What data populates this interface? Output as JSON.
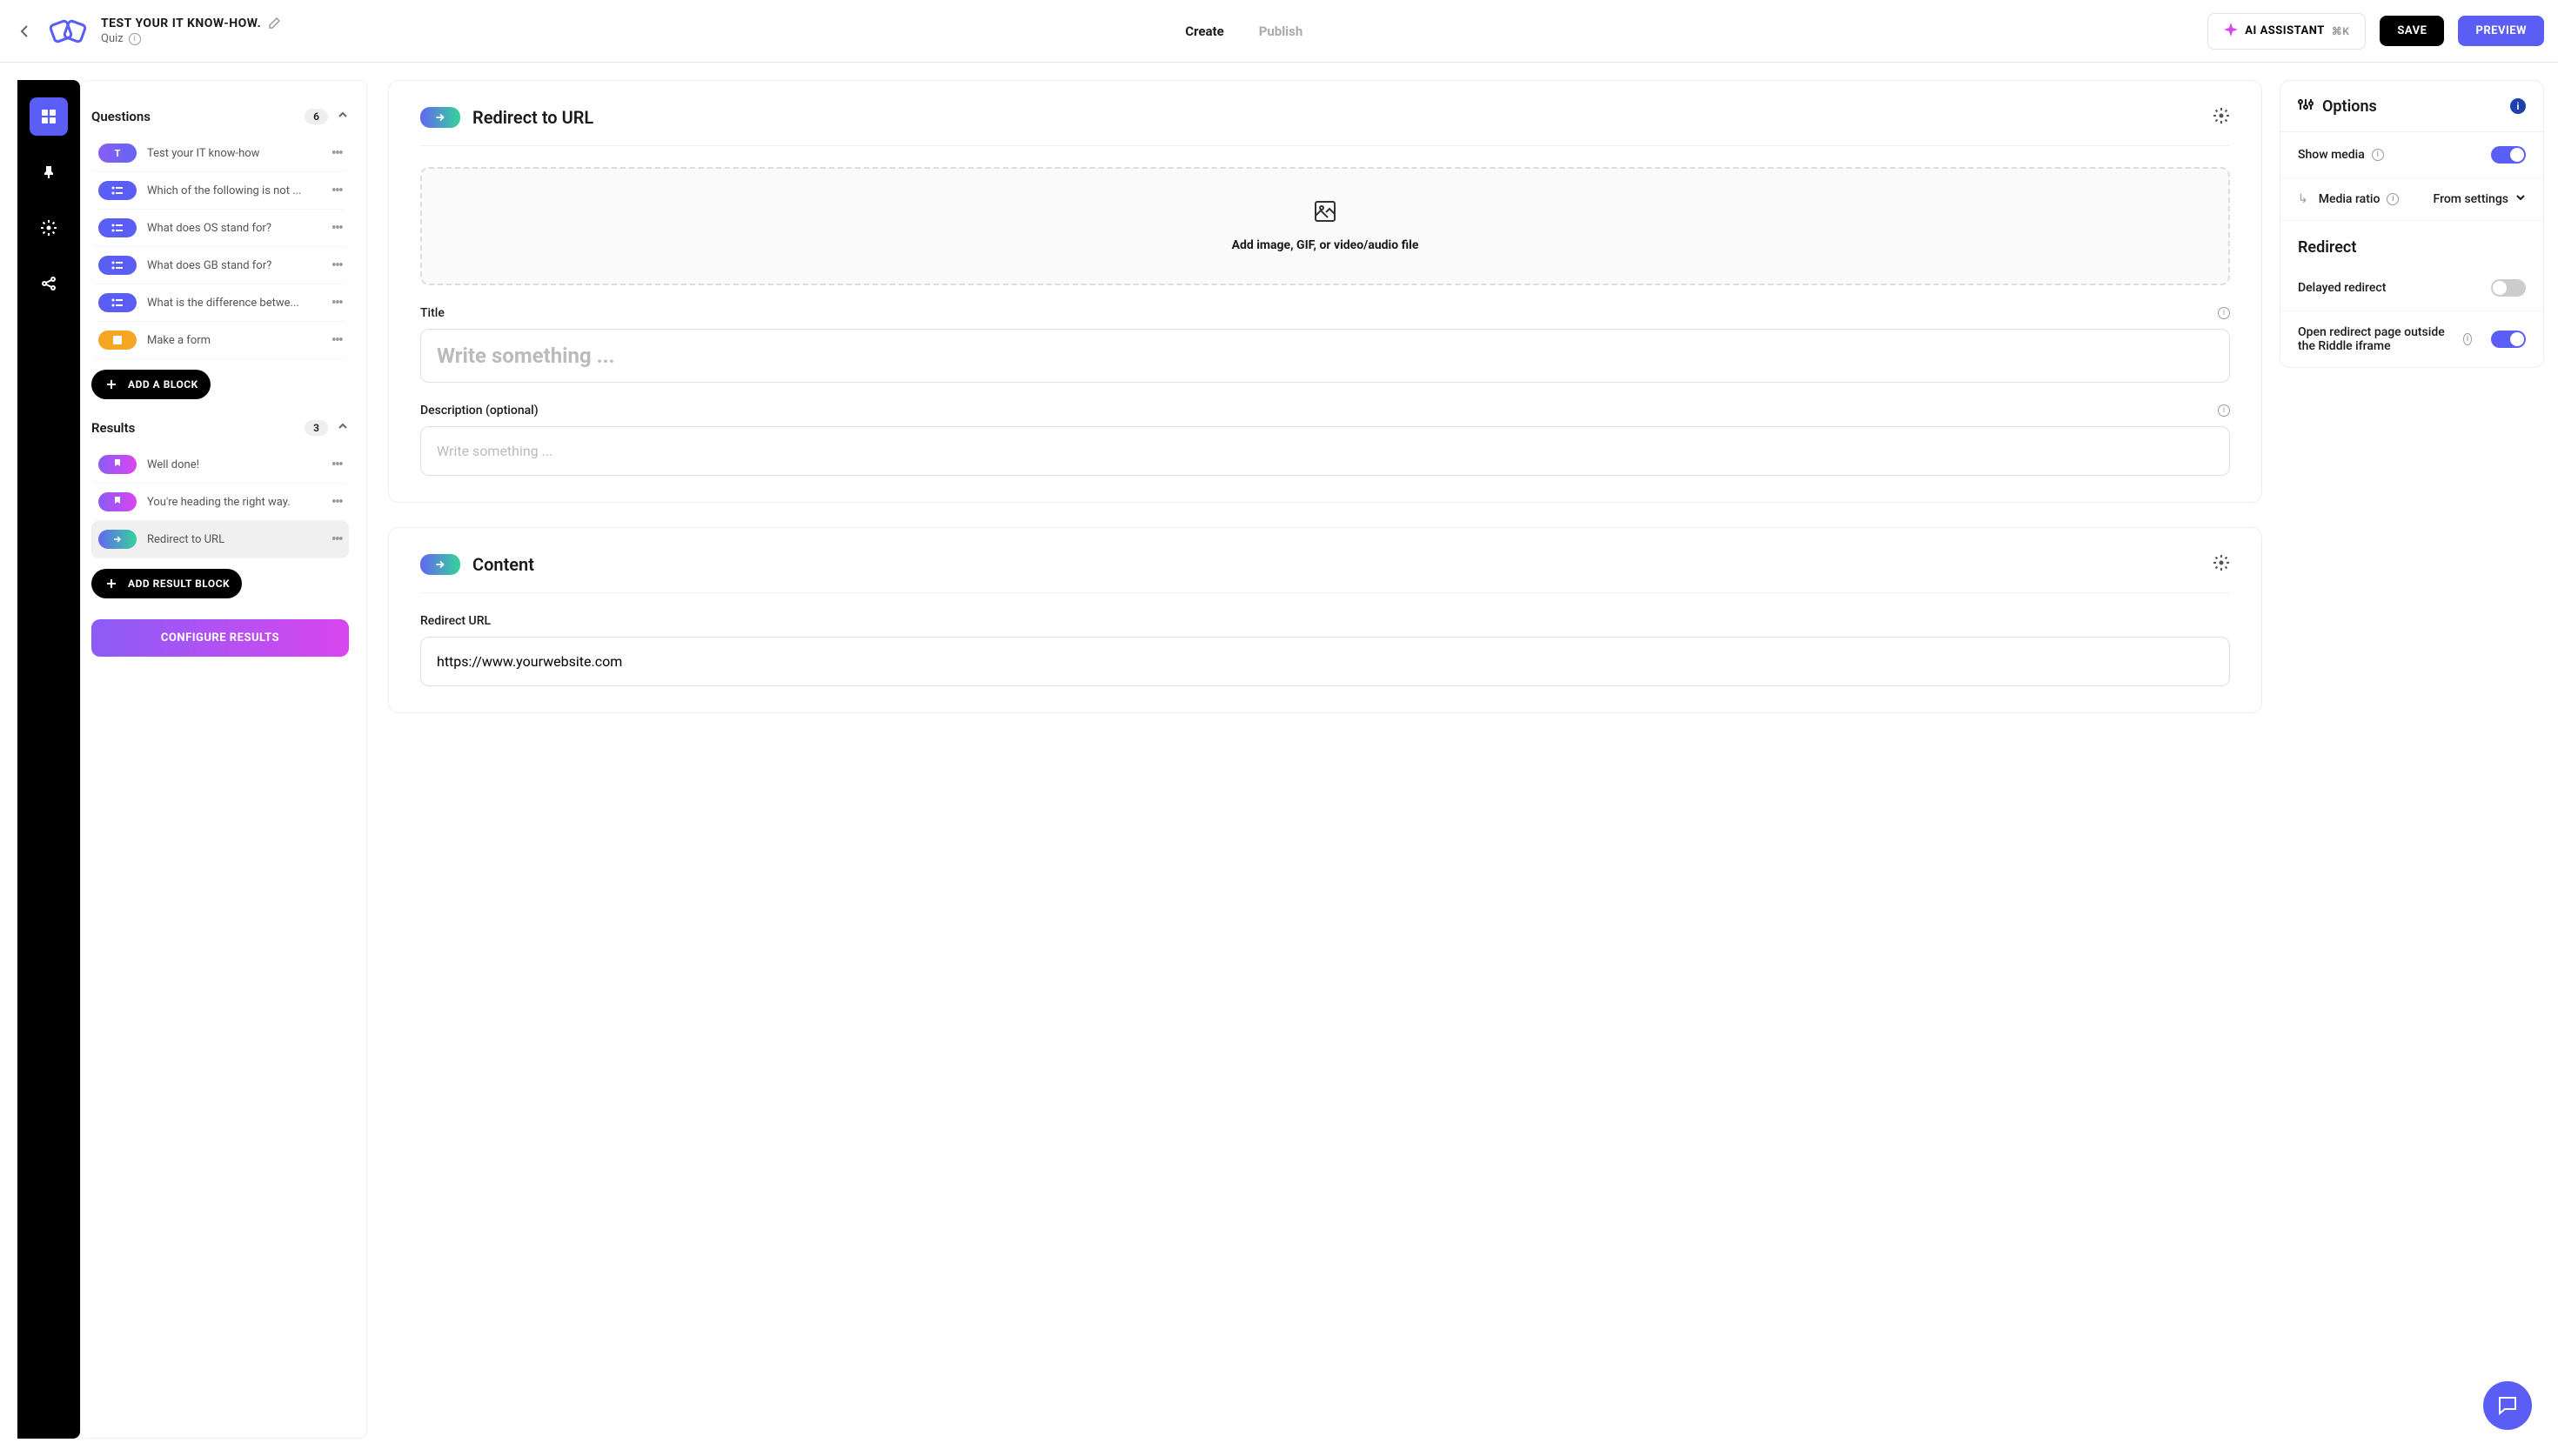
{
  "header": {
    "title": "TEST YOUR IT KNOW-HOW.",
    "subtitle": "Quiz",
    "nav": {
      "create": "Create",
      "publish": "Publish"
    },
    "ai": "AI ASSISTANT",
    "shortcut": "⌘K",
    "save": "SAVE",
    "preview": "PREVIEW"
  },
  "blocks": {
    "questions_label": "Questions",
    "questions_count": "6",
    "items": [
      {
        "label": "Test your IT know-how"
      },
      {
        "label": "Which of the following is not ..."
      },
      {
        "label": "What does OS stand for?"
      },
      {
        "label": "What does GB stand for?"
      },
      {
        "label": "What is the difference betwe..."
      },
      {
        "label": "Make a form"
      }
    ],
    "add_block": "ADD A BLOCK",
    "results_label": "Results",
    "results_count": "3",
    "results": [
      {
        "label": "Well done!"
      },
      {
        "label": "You're heading the right way."
      },
      {
        "label": "Redirect to URL"
      }
    ],
    "add_result": "ADD RESULT BLOCK",
    "configure": "CONFIGURE RESULTS"
  },
  "main": {
    "redirect_title": "Redirect to URL",
    "media_box": "Add image, GIF, or video/audio file",
    "title_label": "Title",
    "title_placeholder": "Write something ...",
    "desc_label": "Description (optional)",
    "desc_placeholder": "Write something ...",
    "content_title": "Content",
    "url_label": "Redirect URL",
    "url_value": "https://www.yourwebsite.com"
  },
  "options": {
    "title": "Options",
    "show_media": "Show media",
    "media_ratio": "Media ratio",
    "media_ratio_value": "From settings",
    "redirect_section": "Redirect",
    "delayed": "Delayed redirect",
    "open_outside": "Open redirect page outside the Riddle iframe"
  }
}
